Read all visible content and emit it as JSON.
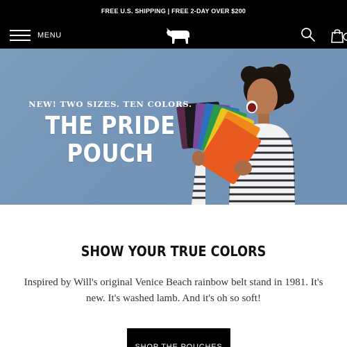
{
  "promo": {
    "text": "FREE U.S. SHIPPING | FREE 2-DAY OVER $200"
  },
  "header": {
    "menu_label": "MENU",
    "logo_icon": "bull-icon",
    "search_icon": "search-icon",
    "cart_icon": "shopping-bag-icon"
  },
  "hero": {
    "kicker": "NEW! TWO SIZES. TEN COLORS.",
    "title_line1": "THE PRIDE",
    "title_line2": "POUCH",
    "pouch_colors": [
      "#5a2a4a",
      "#1a1a1a",
      "#7a4a9a",
      "#2f6fc0",
      "#2a9a4a",
      "#e8c520",
      "#ef8a1a",
      "#e85a20"
    ]
  },
  "section": {
    "title": "SHOW YOUR TRUE COLORS",
    "body": "Inspired by Will's original Venice Beach rainbow belt stand in 1981. It's new. It's washed lamb. And it's oh so soft!",
    "cta_label": "SHOP THE POUCHES"
  },
  "colors": {
    "bar": "#000000",
    "hero_bg": "#7295b8",
    "text_dark": "#111111"
  }
}
